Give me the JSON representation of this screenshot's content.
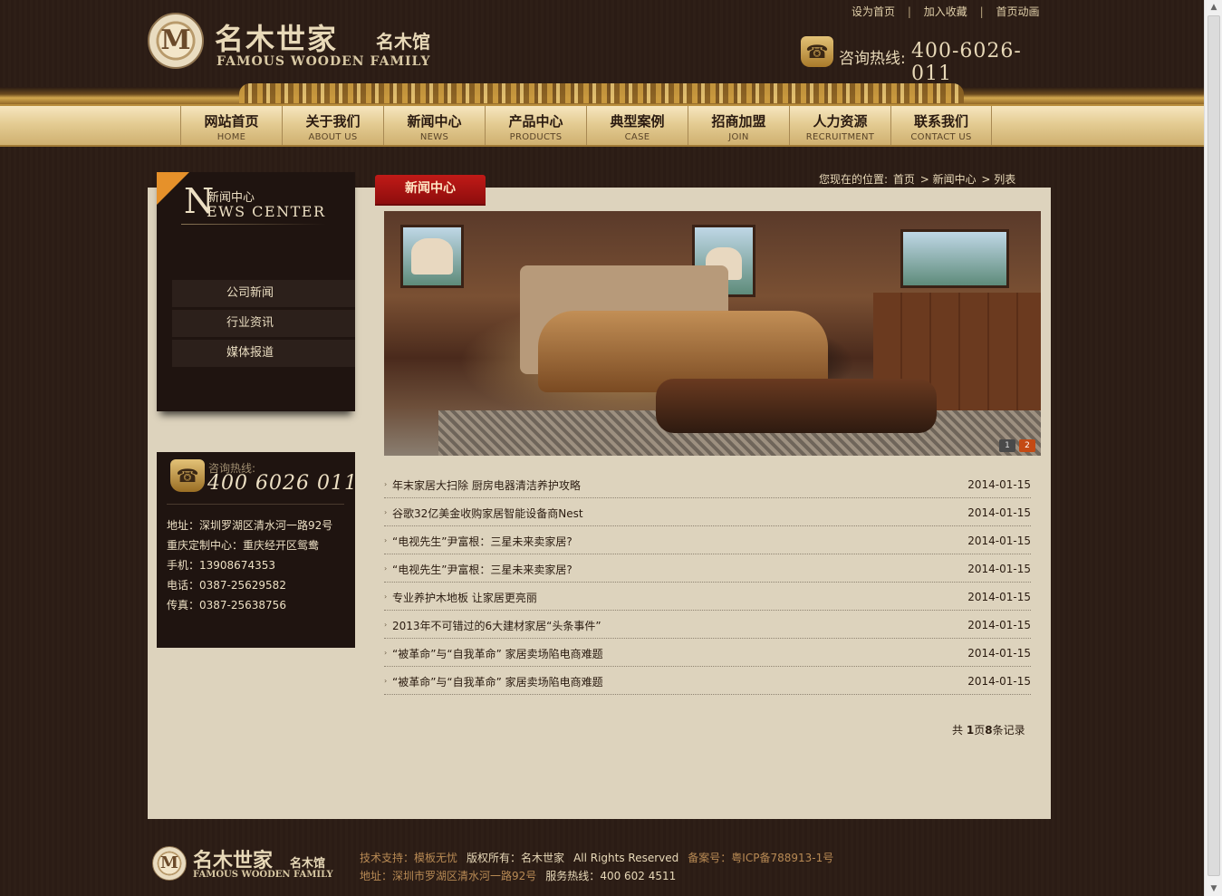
{
  "header": {
    "logo": {
      "cn": "名木世家",
      "sub": "名木馆",
      "en": "FAMOUS WOODEN FAMILY",
      "seal": "M"
    },
    "toplinks": [
      "设为首页",
      "加入收藏",
      "首页动画"
    ],
    "hotline": {
      "label": "咨询热线:",
      "number": "400-6026-011"
    }
  },
  "nav": [
    {
      "cn": "网站首页",
      "en": "HOME"
    },
    {
      "cn": "关于我们",
      "en": "ABOUT US"
    },
    {
      "cn": "新闻中心",
      "en": "NEWS"
    },
    {
      "cn": "产品中心",
      "en": "PRODUCTS"
    },
    {
      "cn": "典型案例",
      "en": "CASE"
    },
    {
      "cn": "招商加盟",
      "en": "JOIN"
    },
    {
      "cn": "人力资源",
      "en": "RECRUITMENT"
    },
    {
      "cn": "联系我们",
      "en": "CONTACT US"
    }
  ],
  "sidebar": {
    "title_cn": "新闻中心",
    "title_big": "N",
    "title_en": "EWS CENTER",
    "menu": [
      "公司新闻",
      "行业资讯",
      "媒体报道"
    ],
    "hotline_label": "咨询热线:",
    "hotline_number": "400 6026 011",
    "contacts": [
      "地址：深圳罗湖区清水河一路92号",
      "重庆定制中心：重庆经开区鸳鸯",
      "手机：13908674353",
      "电话：0387-25629582",
      "传真：0387-25638756"
    ]
  },
  "main": {
    "tab": "新闻中心",
    "breadcrumb": {
      "label": "您现在的位置:",
      "items": [
        "首页",
        "> 新闻中心",
        "> 列表"
      ]
    },
    "banner_dots": [
      "1",
      "2"
    ],
    "news": [
      {
        "title": "年末家居大扫除  厨房电器清洁养护攻略",
        "date": "2014-01-15"
      },
      {
        "title": "谷歌32亿美金收购家居智能设备商Nest",
        "date": "2014-01-15"
      },
      {
        "title": "“电视先生”尹富根：三星未来卖家居?",
        "date": "2014-01-15"
      },
      {
        "title": "“电视先生”尹富根：三星未来卖家居?",
        "date": "2014-01-15"
      },
      {
        "title": "专业养护木地板  让家居更亮丽",
        "date": "2014-01-15"
      },
      {
        "title": "2013年不可错过的6大建材家居“头条事件”",
        "date": "2014-01-15"
      },
      {
        "title": "“被革命”与“自我革命”  家居卖场陷电商难题",
        "date": "2014-01-15"
      },
      {
        "title": "“被革命”与“自我革命”  家居卖场陷电商难题",
        "date": "2014-01-15"
      }
    ],
    "pager": {
      "prefix": "共 ",
      "pages": "1",
      "mid": "页",
      "records": "8",
      "suffix": "条记录"
    }
  },
  "footer": {
    "logo": {
      "cn": "名木世家",
      "sub": "名木馆",
      "en": "FAMOUS WOODEN FAMILY",
      "seal": "M"
    },
    "support_label": "技术支持：",
    "support_value": "模板无忧",
    "copyright_label": "版权所有：",
    "copyright_value": "名木世家",
    "rights": "All Rights Reserved",
    "icp_label": "备案号：",
    "icp_value": "粤ICP备788913-1号",
    "address_label": "地址：",
    "address_value": "深圳市罗湖区清水河一路92号",
    "service_label": "服务热线：",
    "service_value": "400 602 4511"
  }
}
